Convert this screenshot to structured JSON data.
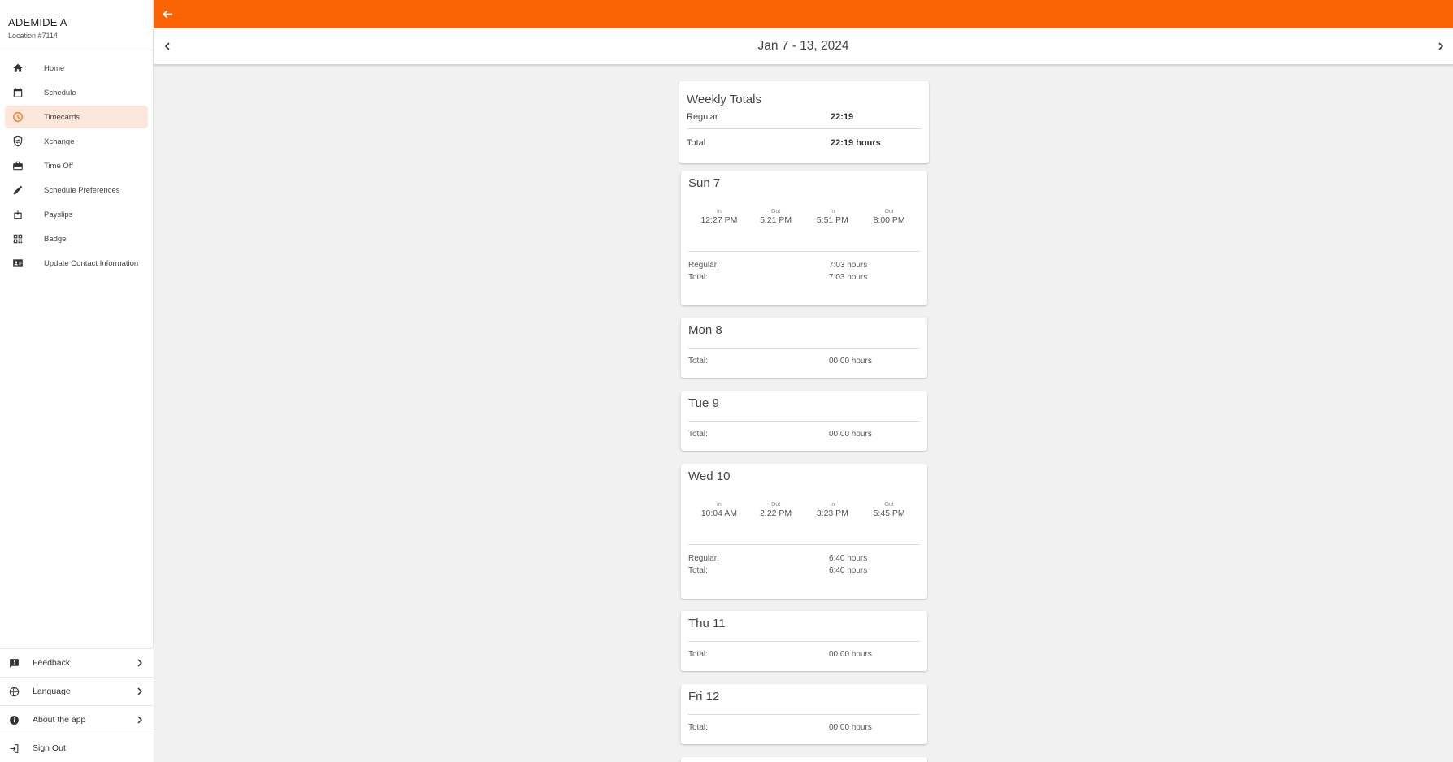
{
  "user": {
    "name": "ADEMIDE A",
    "location": "Location #7114"
  },
  "nav": [
    {
      "label": "Home",
      "icon": "home-icon"
    },
    {
      "label": "Schedule",
      "icon": "calendar-icon"
    },
    {
      "label": "Timecards",
      "icon": "clock-icon",
      "active": true
    },
    {
      "label": "Xchange",
      "icon": "xchange-icon"
    },
    {
      "label": "Time Off",
      "icon": "briefcase-icon"
    },
    {
      "label": "Schedule Preferences",
      "icon": "pencil-icon"
    },
    {
      "label": "Payslips",
      "icon": "payslip-icon"
    },
    {
      "label": "Badge",
      "icon": "qr-code-icon"
    },
    {
      "label": "Update Contact Information",
      "icon": "contact-card-icon"
    }
  ],
  "bottom_menu": [
    {
      "label": "Feedback",
      "icon": "feedback-icon"
    },
    {
      "label": "Language",
      "icon": "globe-icon"
    },
    {
      "label": "About the app",
      "icon": "info-icon"
    },
    {
      "label": "Sign Out",
      "icon": "sign-out-icon"
    }
  ],
  "week": {
    "title": "Jan 7 - 13, 2024"
  },
  "totals": {
    "title": "Weekly Totals",
    "regular_label": "Regular:",
    "regular_value": "22:19",
    "total_label": "Total",
    "total_value": "22:19 hours"
  },
  "days": [
    {
      "title": "Sun 7",
      "punches": [
        {
          "type": "In",
          "time": "12:27 PM"
        },
        {
          "type": "Out",
          "time": "5:21 PM"
        },
        {
          "type": "In",
          "time": "5:51 PM"
        },
        {
          "type": "Out",
          "time": "8:00 PM"
        }
      ],
      "regular_label": "Regular:",
      "regular_value": "7:03 hours",
      "total_label": "Total:",
      "total_value": "7:03 hours"
    },
    {
      "title": "Mon 8",
      "total_label": "Total:",
      "total_value": "00:00 hours"
    },
    {
      "title": "Tue 9",
      "total_label": "Total:",
      "total_value": "00:00 hours"
    },
    {
      "title": "Wed 10",
      "punches": [
        {
          "type": "In",
          "time": "10:04 AM"
        },
        {
          "type": "Out",
          "time": "2:22 PM"
        },
        {
          "type": "In",
          "time": "3:23 PM"
        },
        {
          "type": "Out",
          "time": "5:45 PM"
        }
      ],
      "regular_label": "Regular:",
      "regular_value": "6:40 hours",
      "total_label": "Total:",
      "total_value": "6:40 hours"
    },
    {
      "title": "Thu 11",
      "total_label": "Total:",
      "total_value": "00:00 hours"
    },
    {
      "title": "Fri 12",
      "total_label": "Total:",
      "total_value": "00:00 hours"
    }
  ],
  "colors": {
    "brand": "#fb6405",
    "active_nav_bg": "#fde6da",
    "page_bg": "#f1f1f1"
  }
}
